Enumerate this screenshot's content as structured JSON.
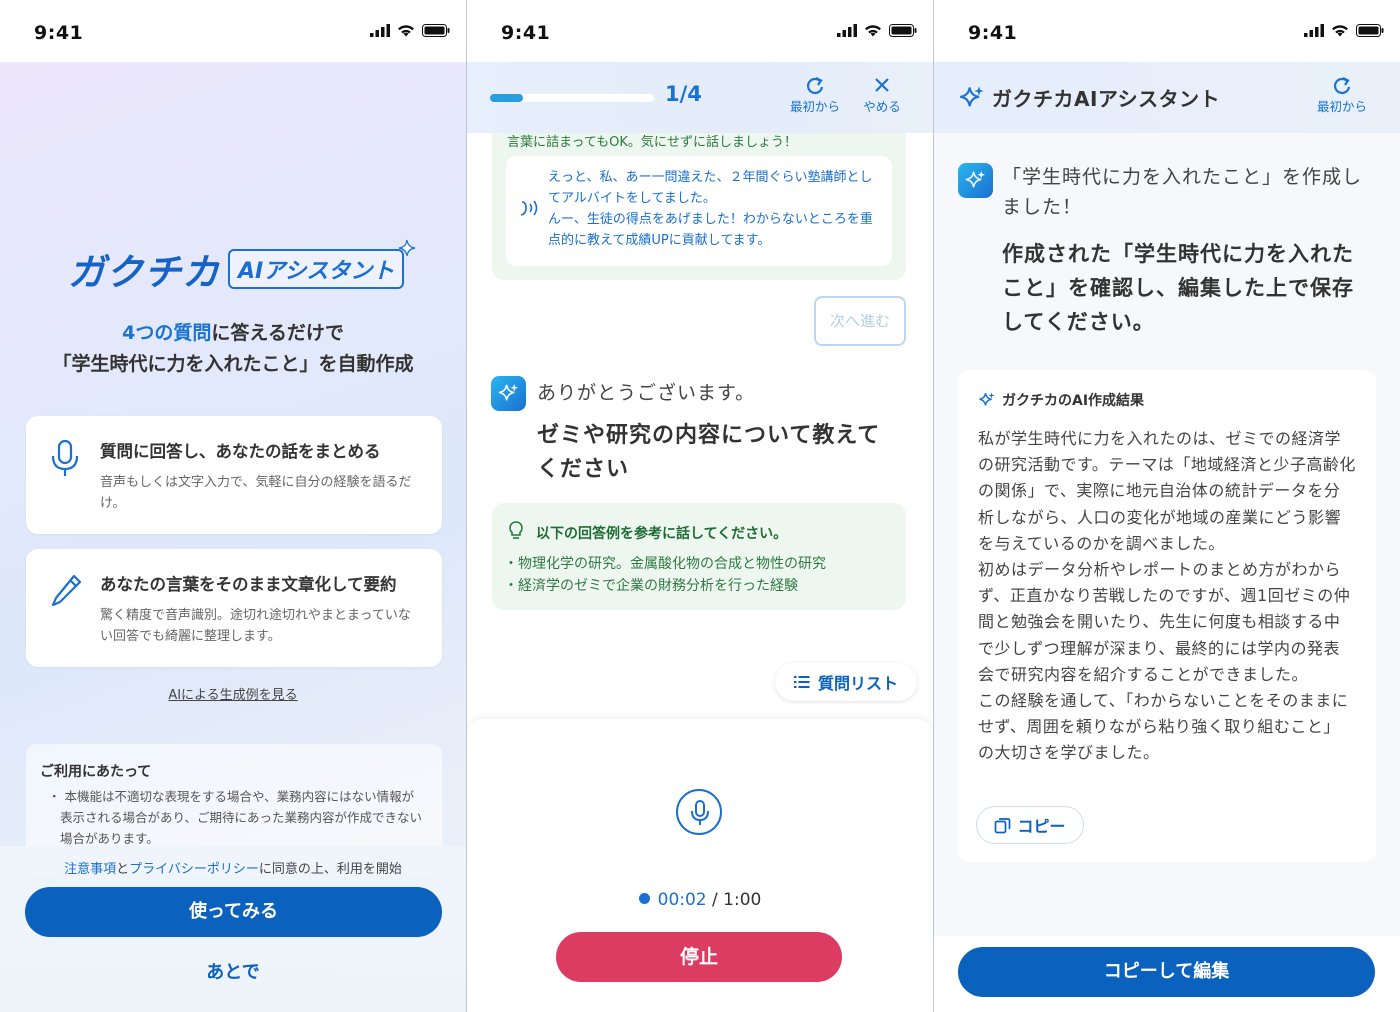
{
  "status": {
    "time": "9:41"
  },
  "welcome": {
    "logo_main": "ガクチカ",
    "logo_badge": "AIアシスタント",
    "lead_hl": "4つの質問",
    "lead_rest": "に答えるだけで",
    "lead_line2": "「学生時代に力を入れたこと」を自動作成",
    "features": [
      {
        "title": "質問に回答し、あなたの話をまとめる",
        "desc": "音声もしくは文字入力で、気軽に自分の経験を語るだけ。"
      },
      {
        "title": "あなたの言葉をそのまま文章化して要約",
        "desc": "驚く精度で音声識別。途切れ途切れやまとまっていない回答でも綺麗に整理します。"
      }
    ],
    "sample_link": "AIによる生成例を見る",
    "notice_title": "ご利用にあたって",
    "notice_body": "・ 本機能は不適切な表現をする場合や、業務内容にはない情報が表示される場合があり、ご期待にあった業務内容が作成できない場合があります。",
    "agree_link1": "注意事項",
    "agree_mid": "と",
    "agree_link2": "プライバシーポリシー",
    "agree_rest": "に同意の上、利用を開始",
    "try_label": "使ってみる",
    "later_label": "あとで"
  },
  "interview": {
    "step": "1/4",
    "progress": 0.2,
    "restart_label": "最初から",
    "quit_label": "やめる",
    "cut_text": "言葉に詰まってもOK。気にせずに話しましょう！",
    "bubble_text": "えっと、私、あー一問違えた、２年間ぐらい塾講師としてアルバイトをしてました。\nんー、生徒の得点をあげました！わからないところを重点的に教えて成績UPに貢献してます。",
    "next_label": "次へ進む",
    "thanks": "ありがとうございます。",
    "question": "ゼミや研究の内容について教えてください",
    "hint_title": "以下の回答例を参考に話してください。",
    "hints": [
      "・物理化学の研究。金属酸化物の合成と物性の研究",
      "・経済学のゼミで企業の財務分析を行った経験"
    ],
    "question_list_label": "質問リスト",
    "timer_current": "00:02",
    "timer_sep": " / ",
    "timer_total": "1:00",
    "stop_label": "停止"
  },
  "result": {
    "title": "ガクチカAIアシスタント",
    "restart_label": "最初から",
    "message": "「学生時代に力を入れたこと」を作成しました！",
    "instruction": "作成された「学生時代に力を入れたこと」を確認し、編集した上で保存してください。",
    "card_title": "ガクチカのAI作成結果",
    "card_text": "私が学生時代に力を入れたのは、ゼミでの経済学の研究活動です。テーマは「地域経済と少子高齢化の関係」で、実際に地元自治体の統計データを分析しながら、人口の変化が地域の産業にどう影響を与えているのかを調べました。\n初めはデータ分析やレポートのまとめ方がわからず、正直かなり苦戦したのですが、週1回ゼミの仲間と勉強会を開いたり、先生に何度も相談する中で少しずつ理解が深まり、最終的には学内の発表会で研究内容を紹介することができました。\nこの経験を通して、「わからないことをそのままにせず、周囲を頼りながら粘り強く取り組むこと」の大切さを学びました。",
    "copy_label": "コピー",
    "copy_edit_label": "コピーして編集"
  },
  "colors": {
    "primary": "#0a62be",
    "accent": "#1a73d0",
    "stop": "#dc3c61",
    "hint_green": "#eef7ef"
  }
}
